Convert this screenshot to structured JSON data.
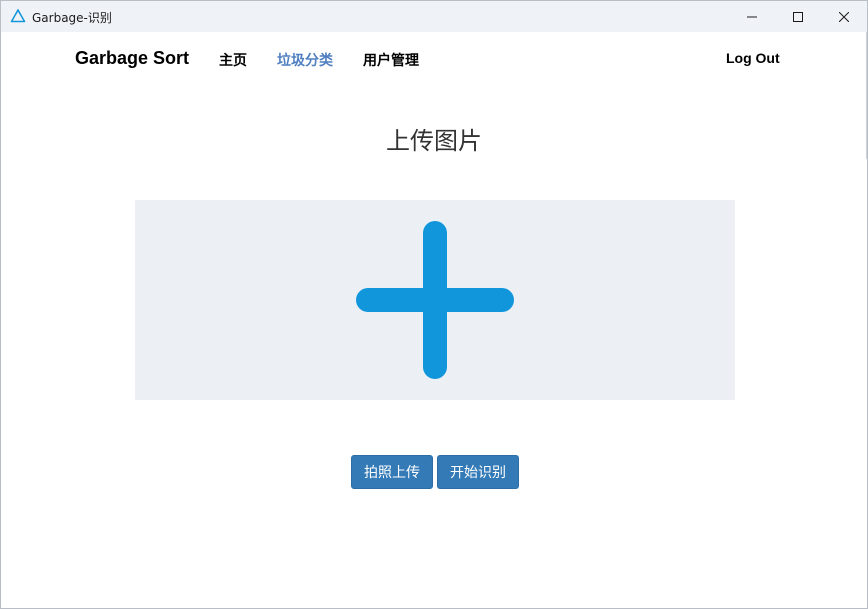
{
  "window": {
    "title": "Garbage-识别"
  },
  "navbar": {
    "brand": "Garbage Sort",
    "links": [
      {
        "label": "主页",
        "active": false
      },
      {
        "label": "垃圾分类",
        "active": true
      },
      {
        "label": "用户管理",
        "active": false
      }
    ],
    "logout": "Log Out"
  },
  "main": {
    "title": "上传图片",
    "upload_icon": "plus-icon",
    "buttons": {
      "photo_upload": "拍照上传",
      "start_recognition": "开始识别"
    }
  },
  "colors": {
    "accent": "#1296db",
    "button": "#337ab7",
    "active_link": "#4f7fc0",
    "upload_bg": "#ecf0f5",
    "titlebar_bg": "#eff3f8"
  },
  "icons": {
    "app": "recycle-triangle-icon",
    "minimize": "minimize-icon",
    "maximize": "maximize-icon",
    "close": "close-icon"
  }
}
